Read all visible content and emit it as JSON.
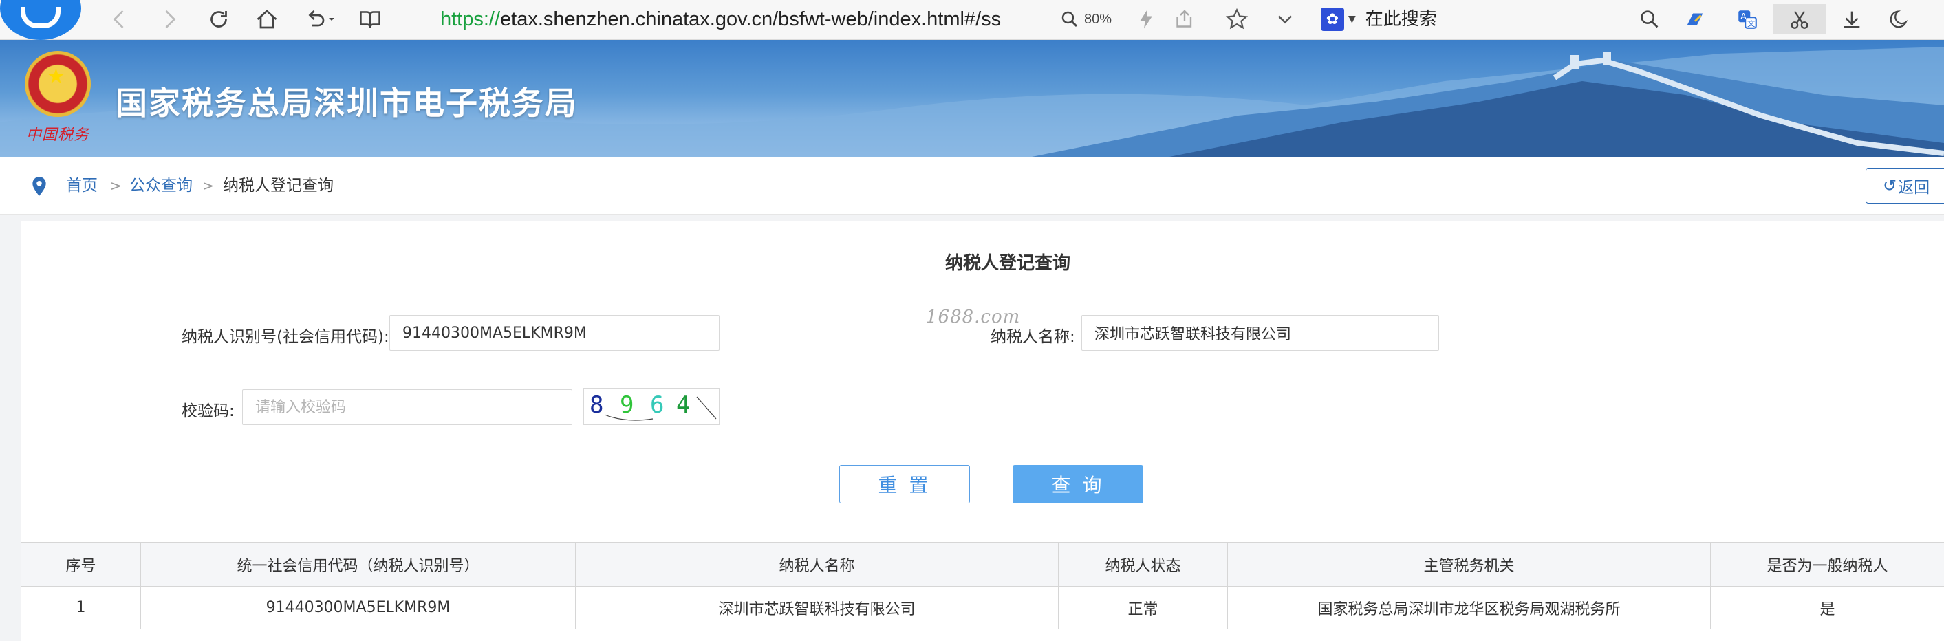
{
  "browser": {
    "url_scheme": "https://",
    "url_rest": "etax.shenzhen.chinatax.gov.cn/bsfwt-web/index.html#/ss",
    "zoom": "80%",
    "search_placeholder": "在此搜索"
  },
  "site": {
    "title": "国家税务总局深圳市电子税务局",
    "logo_text": "中国税务"
  },
  "breadcrumb": {
    "home": "首页",
    "sep": ">",
    "section": "公众查询",
    "current": "纳税人登记查询",
    "back_label": "返回"
  },
  "form": {
    "title": "纳税人登记查询",
    "taxpayer_id_label": "纳税人识别号(社会信用代码):",
    "taxpayer_id_value": "91440300MA5ELKMR9M",
    "taxpayer_name_label": "纳税人名称:",
    "taxpayer_name_value": "深圳市芯跃智联科技有限公司",
    "captcha_label": "校验码:",
    "captcha_placeholder": "请输入校验码",
    "captcha_chars": [
      "8",
      "9",
      "6",
      "4"
    ],
    "reset_label": "重 置",
    "query_label": "查 询",
    "watermark": "1688.com"
  },
  "table": {
    "headers": [
      "序号",
      "统一社会信用代码（纳税人识别号）",
      "纳税人名称",
      "纳税人状态",
      "主管税务机关",
      "是否为一般纳税人"
    ],
    "rows": [
      [
        "1",
        "91440300MA5ELKMR9M",
        "深圳市芯跃智联科技有限公司",
        "正常",
        "国家税务总局深圳市龙华区税务局观湖税务所",
        "是"
      ]
    ]
  },
  "colors": {
    "link": "#2f6db7",
    "query_button": "#5aa9ef",
    "url_scheme": "#18a03e"
  }
}
